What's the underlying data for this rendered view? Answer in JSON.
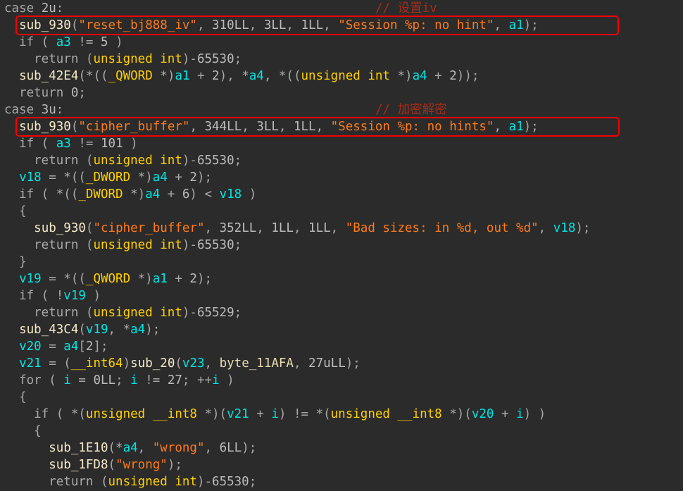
{
  "editor": {
    "name": "decompiler-pseudocode-view",
    "background_color": "#2b2b2b",
    "palette": {
      "keyword": "#ffd000",
      "function": "#f5e9c8",
      "variable": "#00e5e5",
      "string": "#ff7b1a",
      "number": "#bcbcbc",
      "plain": "#a9a9a9",
      "comment": "#a32d1b",
      "highlight_box": "#f40000"
    }
  },
  "annotations": {
    "comments": [
      {
        "id": "comment-1",
        "text": "// 设置iv"
      },
      {
        "id": "comment-2",
        "text": "// 加密解密"
      }
    ],
    "highlight_boxes": [
      {
        "id": "hl-box-1",
        "target_line": 1
      },
      {
        "id": "hl-box-2",
        "target_line": 7
      }
    ]
  },
  "code": {
    "lines": [
      {
        "n": 0,
        "tokens": [
          {
            "c": "plain",
            "t": "case "
          },
          {
            "c": "num",
            "t": "2u"
          },
          {
            "c": "plain",
            "t": ":"
          }
        ]
      },
      {
        "n": 1,
        "tokens": [
          {
            "c": "plain",
            "t": "  "
          },
          {
            "c": "fn",
            "t": "sub_930"
          },
          {
            "c": "plain",
            "t": "("
          },
          {
            "c": "str",
            "t": "\"reset_bj888_iv\""
          },
          {
            "c": "plain",
            "t": ", "
          },
          {
            "c": "num",
            "t": "310LL"
          },
          {
            "c": "plain",
            "t": ", "
          },
          {
            "c": "num",
            "t": "3LL"
          },
          {
            "c": "plain",
            "t": ", "
          },
          {
            "c": "num",
            "t": "1LL"
          },
          {
            "c": "plain",
            "t": ", "
          },
          {
            "c": "str",
            "t": "\"Session %p: no hint\""
          },
          {
            "c": "plain",
            "t": ", "
          },
          {
            "c": "var",
            "t": "a1"
          },
          {
            "c": "plain",
            "t": ");"
          }
        ]
      },
      {
        "n": 2,
        "tokens": [
          {
            "c": "plain",
            "t": "  if ( "
          },
          {
            "c": "var",
            "t": "a3"
          },
          {
            "c": "plain",
            "t": " != "
          },
          {
            "c": "num",
            "t": "5"
          },
          {
            "c": "plain",
            "t": " )"
          }
        ]
      },
      {
        "n": 3,
        "tokens": [
          {
            "c": "plain",
            "t": "    return ("
          },
          {
            "c": "kw",
            "t": "unsigned int"
          },
          {
            "c": "plain",
            "t": ")-"
          },
          {
            "c": "num",
            "t": "65530"
          },
          {
            "c": "plain",
            "t": ";"
          }
        ]
      },
      {
        "n": 4,
        "tokens": [
          {
            "c": "plain",
            "t": "  "
          },
          {
            "c": "fn",
            "t": "sub_42E4"
          },
          {
            "c": "plain",
            "t": "(*(("
          },
          {
            "c": "kw",
            "t": "_QWORD"
          },
          {
            "c": "plain",
            "t": " *)"
          },
          {
            "c": "var",
            "t": "a1"
          },
          {
            "c": "plain",
            "t": " + "
          },
          {
            "c": "num",
            "t": "2"
          },
          {
            "c": "plain",
            "t": "), *"
          },
          {
            "c": "var",
            "t": "a4"
          },
          {
            "c": "plain",
            "t": ", *(("
          },
          {
            "c": "kw",
            "t": "unsigned int"
          },
          {
            "c": "plain",
            "t": " *)"
          },
          {
            "c": "var",
            "t": "a4"
          },
          {
            "c": "plain",
            "t": " + "
          },
          {
            "c": "num",
            "t": "2"
          },
          {
            "c": "plain",
            "t": "));"
          }
        ]
      },
      {
        "n": 5,
        "tokens": [
          {
            "c": "plain",
            "t": "  return "
          },
          {
            "c": "num",
            "t": "0"
          },
          {
            "c": "plain",
            "t": ";"
          }
        ]
      },
      {
        "n": 6,
        "tokens": [
          {
            "c": "plain",
            "t": "case "
          },
          {
            "c": "num",
            "t": "3u"
          },
          {
            "c": "plain",
            "t": ":"
          }
        ]
      },
      {
        "n": 7,
        "tokens": [
          {
            "c": "plain",
            "t": "  "
          },
          {
            "c": "fn",
            "t": "sub_930"
          },
          {
            "c": "plain",
            "t": "("
          },
          {
            "c": "str",
            "t": "\"cipher_buffer\""
          },
          {
            "c": "plain",
            "t": ", "
          },
          {
            "c": "num",
            "t": "344LL"
          },
          {
            "c": "plain",
            "t": ", "
          },
          {
            "c": "num",
            "t": "3LL"
          },
          {
            "c": "plain",
            "t": ", "
          },
          {
            "c": "num",
            "t": "1LL"
          },
          {
            "c": "plain",
            "t": ", "
          },
          {
            "c": "str",
            "t": "\"Session %p: no hints\""
          },
          {
            "c": "plain",
            "t": ", "
          },
          {
            "c": "var",
            "t": "a1"
          },
          {
            "c": "plain",
            "t": ");"
          }
        ]
      },
      {
        "n": 8,
        "tokens": [
          {
            "c": "plain",
            "t": "  if ( "
          },
          {
            "c": "var",
            "t": "a3"
          },
          {
            "c": "plain",
            "t": " != "
          },
          {
            "c": "num",
            "t": "101"
          },
          {
            "c": "plain",
            "t": " )"
          }
        ]
      },
      {
        "n": 9,
        "tokens": [
          {
            "c": "plain",
            "t": "    return ("
          },
          {
            "c": "kw",
            "t": "unsigned int"
          },
          {
            "c": "plain",
            "t": ")-"
          },
          {
            "c": "num",
            "t": "65530"
          },
          {
            "c": "plain",
            "t": ";"
          }
        ]
      },
      {
        "n": 10,
        "tokens": [
          {
            "c": "plain",
            "t": "  "
          },
          {
            "c": "var",
            "t": "v18"
          },
          {
            "c": "plain",
            "t": " = *(("
          },
          {
            "c": "kw",
            "t": "_DWORD"
          },
          {
            "c": "plain",
            "t": " *)"
          },
          {
            "c": "var",
            "t": "a4"
          },
          {
            "c": "plain",
            "t": " + "
          },
          {
            "c": "num",
            "t": "2"
          },
          {
            "c": "plain",
            "t": ");"
          }
        ]
      },
      {
        "n": 11,
        "tokens": [
          {
            "c": "plain",
            "t": "  if ( *(("
          },
          {
            "c": "kw",
            "t": "_DWORD"
          },
          {
            "c": "plain",
            "t": " *)"
          },
          {
            "c": "var",
            "t": "a4"
          },
          {
            "c": "plain",
            "t": " + "
          },
          {
            "c": "num",
            "t": "6"
          },
          {
            "c": "plain",
            "t": ") < "
          },
          {
            "c": "var",
            "t": "v18"
          },
          {
            "c": "plain",
            "t": " )"
          }
        ]
      },
      {
        "n": 12,
        "tokens": [
          {
            "c": "plain",
            "t": "  {"
          }
        ]
      },
      {
        "n": 13,
        "tokens": [
          {
            "c": "plain",
            "t": "    "
          },
          {
            "c": "fn",
            "t": "sub_930"
          },
          {
            "c": "plain",
            "t": "("
          },
          {
            "c": "str",
            "t": "\"cipher_buffer\""
          },
          {
            "c": "plain",
            "t": ", "
          },
          {
            "c": "num",
            "t": "352LL"
          },
          {
            "c": "plain",
            "t": ", "
          },
          {
            "c": "num",
            "t": "1LL"
          },
          {
            "c": "plain",
            "t": ", "
          },
          {
            "c": "num",
            "t": "1LL"
          },
          {
            "c": "plain",
            "t": ", "
          },
          {
            "c": "str",
            "t": "\"Bad sizes: in %d, out %d\""
          },
          {
            "c": "plain",
            "t": ", "
          },
          {
            "c": "var",
            "t": "v18"
          },
          {
            "c": "plain",
            "t": ");"
          }
        ]
      },
      {
        "n": 14,
        "tokens": [
          {
            "c": "plain",
            "t": "    return ("
          },
          {
            "c": "kw",
            "t": "unsigned int"
          },
          {
            "c": "plain",
            "t": ")-"
          },
          {
            "c": "num",
            "t": "65530"
          },
          {
            "c": "plain",
            "t": ";"
          }
        ]
      },
      {
        "n": 15,
        "tokens": [
          {
            "c": "plain",
            "t": "  }"
          }
        ]
      },
      {
        "n": 16,
        "tokens": [
          {
            "c": "plain",
            "t": "  "
          },
          {
            "c": "var",
            "t": "v19"
          },
          {
            "c": "plain",
            "t": " = *(("
          },
          {
            "c": "kw",
            "t": "_QWORD"
          },
          {
            "c": "plain",
            "t": " *)"
          },
          {
            "c": "var",
            "t": "a1"
          },
          {
            "c": "plain",
            "t": " + "
          },
          {
            "c": "num",
            "t": "2"
          },
          {
            "c": "plain",
            "t": ");"
          }
        ]
      },
      {
        "n": 17,
        "tokens": [
          {
            "c": "plain",
            "t": "  if ( !"
          },
          {
            "c": "var",
            "t": "v19"
          },
          {
            "c": "plain",
            "t": " )"
          }
        ]
      },
      {
        "n": 18,
        "tokens": [
          {
            "c": "plain",
            "t": "    return ("
          },
          {
            "c": "kw",
            "t": "unsigned int"
          },
          {
            "c": "plain",
            "t": ")-"
          },
          {
            "c": "num",
            "t": "65529"
          },
          {
            "c": "plain",
            "t": ";"
          }
        ]
      },
      {
        "n": 19,
        "tokens": [
          {
            "c": "plain",
            "t": "  "
          },
          {
            "c": "fn",
            "t": "sub_43C4"
          },
          {
            "c": "plain",
            "t": "("
          },
          {
            "c": "var",
            "t": "v19"
          },
          {
            "c": "plain",
            "t": ", *"
          },
          {
            "c": "var",
            "t": "a4"
          },
          {
            "c": "plain",
            "t": ");"
          }
        ]
      },
      {
        "n": 20,
        "tokens": [
          {
            "c": "plain",
            "t": "  "
          },
          {
            "c": "var",
            "t": "v20"
          },
          {
            "c": "plain",
            "t": " = "
          },
          {
            "c": "var",
            "t": "a4"
          },
          {
            "c": "plain",
            "t": "["
          },
          {
            "c": "num",
            "t": "2"
          },
          {
            "c": "plain",
            "t": "];"
          }
        ]
      },
      {
        "n": 21,
        "tokens": [
          {
            "c": "plain",
            "t": "  "
          },
          {
            "c": "var",
            "t": "v21"
          },
          {
            "c": "plain",
            "t": " = ("
          },
          {
            "c": "kw",
            "t": "__int64"
          },
          {
            "c": "plain",
            "t": ")"
          },
          {
            "c": "fn",
            "t": "sub_20"
          },
          {
            "c": "plain",
            "t": "("
          },
          {
            "c": "var",
            "t": "v23"
          },
          {
            "c": "plain",
            "t": ", "
          },
          {
            "c": "glob",
            "t": "byte_11AFA"
          },
          {
            "c": "plain",
            "t": ", "
          },
          {
            "c": "num",
            "t": "27uLL"
          },
          {
            "c": "plain",
            "t": ");"
          }
        ]
      },
      {
        "n": 22,
        "tokens": [
          {
            "c": "plain",
            "t": "  for ( "
          },
          {
            "c": "var",
            "t": "i"
          },
          {
            "c": "plain",
            "t": " = "
          },
          {
            "c": "num",
            "t": "0LL"
          },
          {
            "c": "plain",
            "t": "; "
          },
          {
            "c": "var",
            "t": "i"
          },
          {
            "c": "plain",
            "t": " != "
          },
          {
            "c": "num",
            "t": "27"
          },
          {
            "c": "plain",
            "t": "; ++"
          },
          {
            "c": "var",
            "t": "i"
          },
          {
            "c": "plain",
            "t": " )"
          }
        ]
      },
      {
        "n": 23,
        "tokens": [
          {
            "c": "plain",
            "t": "  {"
          }
        ]
      },
      {
        "n": 24,
        "tokens": [
          {
            "c": "plain",
            "t": "    if ( *("
          },
          {
            "c": "kw",
            "t": "unsigned __int8"
          },
          {
            "c": "plain",
            "t": " *)("
          },
          {
            "c": "var",
            "t": "v21"
          },
          {
            "c": "plain",
            "t": " + "
          },
          {
            "c": "var",
            "t": "i"
          },
          {
            "c": "plain",
            "t": ") != *("
          },
          {
            "c": "kw",
            "t": "unsigned __int8"
          },
          {
            "c": "plain",
            "t": " *)("
          },
          {
            "c": "var",
            "t": "v20"
          },
          {
            "c": "plain",
            "t": " + "
          },
          {
            "c": "var",
            "t": "i"
          },
          {
            "c": "plain",
            "t": ") )"
          }
        ]
      },
      {
        "n": 25,
        "tokens": [
          {
            "c": "plain",
            "t": "    {"
          }
        ]
      },
      {
        "n": 26,
        "tokens": [
          {
            "c": "plain",
            "t": "      "
          },
          {
            "c": "fn",
            "t": "sub_1E10"
          },
          {
            "c": "plain",
            "t": "(*"
          },
          {
            "c": "var",
            "t": "a4"
          },
          {
            "c": "plain",
            "t": ", "
          },
          {
            "c": "str",
            "t": "\"wrong\""
          },
          {
            "c": "plain",
            "t": ", "
          },
          {
            "c": "num",
            "t": "6LL"
          },
          {
            "c": "plain",
            "t": ");"
          }
        ]
      },
      {
        "n": 27,
        "tokens": [
          {
            "c": "plain",
            "t": "      "
          },
          {
            "c": "fn",
            "t": "sub_1FD8"
          },
          {
            "c": "plain",
            "t": "("
          },
          {
            "c": "str",
            "t": "\"wrong\""
          },
          {
            "c": "plain",
            "t": ");"
          }
        ]
      },
      {
        "n": 28,
        "tokens": [
          {
            "c": "plain",
            "t": "      return ("
          },
          {
            "c": "kw",
            "t": "unsigned int"
          },
          {
            "c": "plain",
            "t": ")-"
          },
          {
            "c": "num",
            "t": "65530"
          },
          {
            "c": "plain",
            "t": ";"
          }
        ]
      }
    ]
  }
}
